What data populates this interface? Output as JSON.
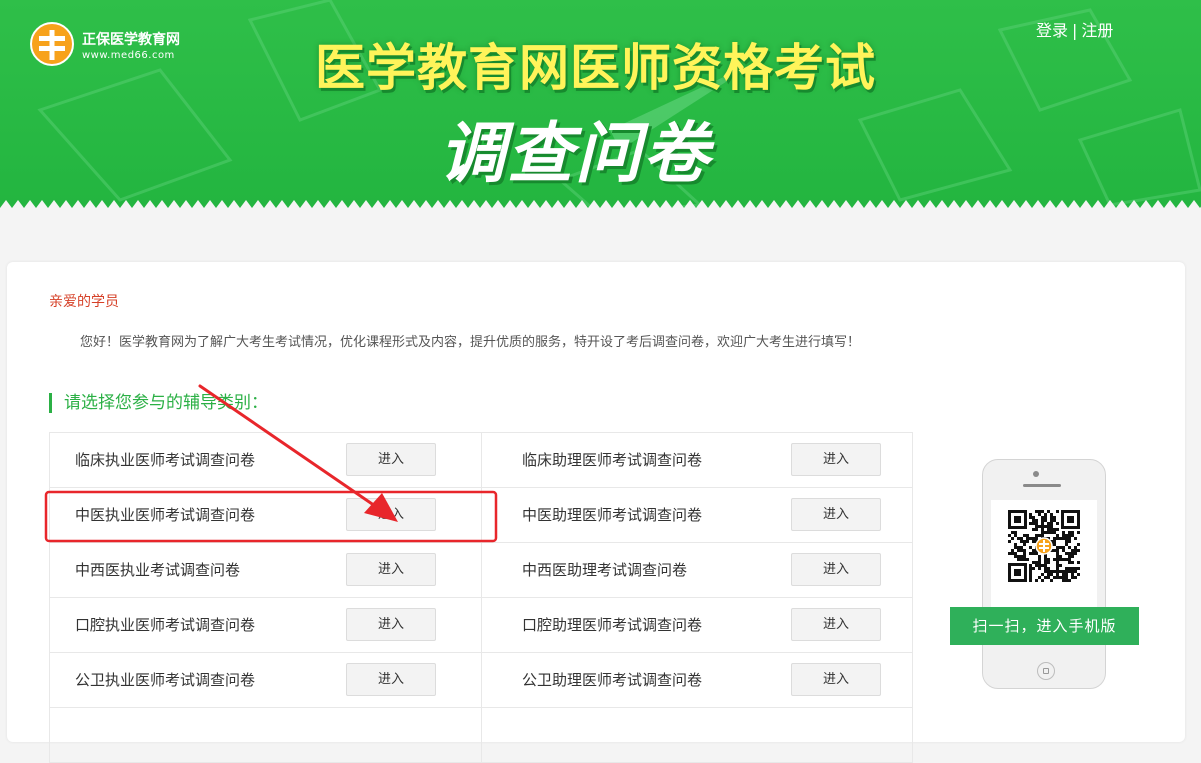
{
  "header": {
    "logo_name": "正保医学教育网",
    "logo_url": "www.med66.com",
    "title": "医学教育网医师资格考试",
    "subtitle": "调查问卷",
    "login": "登录",
    "separator": "|",
    "register": "注册"
  },
  "intro": {
    "greeting": "亲爱的学员",
    "body": "您好！医学教育网为了解广大考生考试情况，优化课程形式及内容，提升优质的服务，特开设了考后调查问卷，欢迎广大考生进行填写！",
    "section_heading": "请选择您参与的辅导类别："
  },
  "surveys": [
    {
      "left": {
        "label": "临床执业医师考试调查问卷",
        "button": "进入"
      },
      "right": {
        "label": "临床助理医师考试调查问卷",
        "button": "进入"
      }
    },
    {
      "left": {
        "label": "中医执业医师考试调查问卷",
        "button": "进入"
      },
      "right": {
        "label": "中医助理医师考试调查问卷",
        "button": "进入"
      }
    },
    {
      "left": {
        "label": "中西医执业考试调查问卷",
        "button": "进入"
      },
      "right": {
        "label": "中西医助理考试调查问卷",
        "button": "进入"
      }
    },
    {
      "left": {
        "label": "口腔执业医师考试调查问卷",
        "button": "进入"
      },
      "right": {
        "label": "口腔助理医师考试调查问卷",
        "button": "进入"
      }
    },
    {
      "left": {
        "label": "公卫执业医师考试调查问卷",
        "button": "进入"
      },
      "right": {
        "label": "公卫助理医师考试调查问卷",
        "button": "进入"
      }
    }
  ],
  "mobile": {
    "scan_label": "扫一扫，进入手机版"
  },
  "colors": {
    "banner_green": "#27b843",
    "title_yellow": "#fff45a",
    "accent_green": "#2bb045",
    "greeting_red": "#d64027",
    "annotation_red": "#e8262b"
  }
}
